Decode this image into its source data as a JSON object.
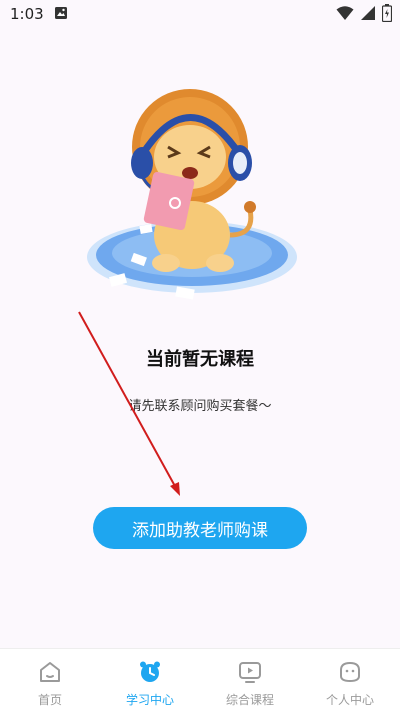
{
  "status_bar": {
    "time": "1:03"
  },
  "empty_state": {
    "title": "当前暂无课程",
    "subtitle": "请先联系顾问购买套餐～"
  },
  "cta": {
    "label": "添加助教老师购课"
  },
  "tabbar": {
    "items": [
      {
        "label": "首页",
        "icon": "home-icon",
        "active": false
      },
      {
        "label": "学习中心",
        "icon": "alarm-clock-icon",
        "active": true
      },
      {
        "label": "综合课程",
        "icon": "tv-icon",
        "active": false
      },
      {
        "label": "个人中心",
        "icon": "profile-icon",
        "active": false
      }
    ]
  },
  "colors": {
    "accent": "#1ea6f0",
    "background": "#fcf8fd",
    "annotation_arrow": "#d11d1d"
  }
}
